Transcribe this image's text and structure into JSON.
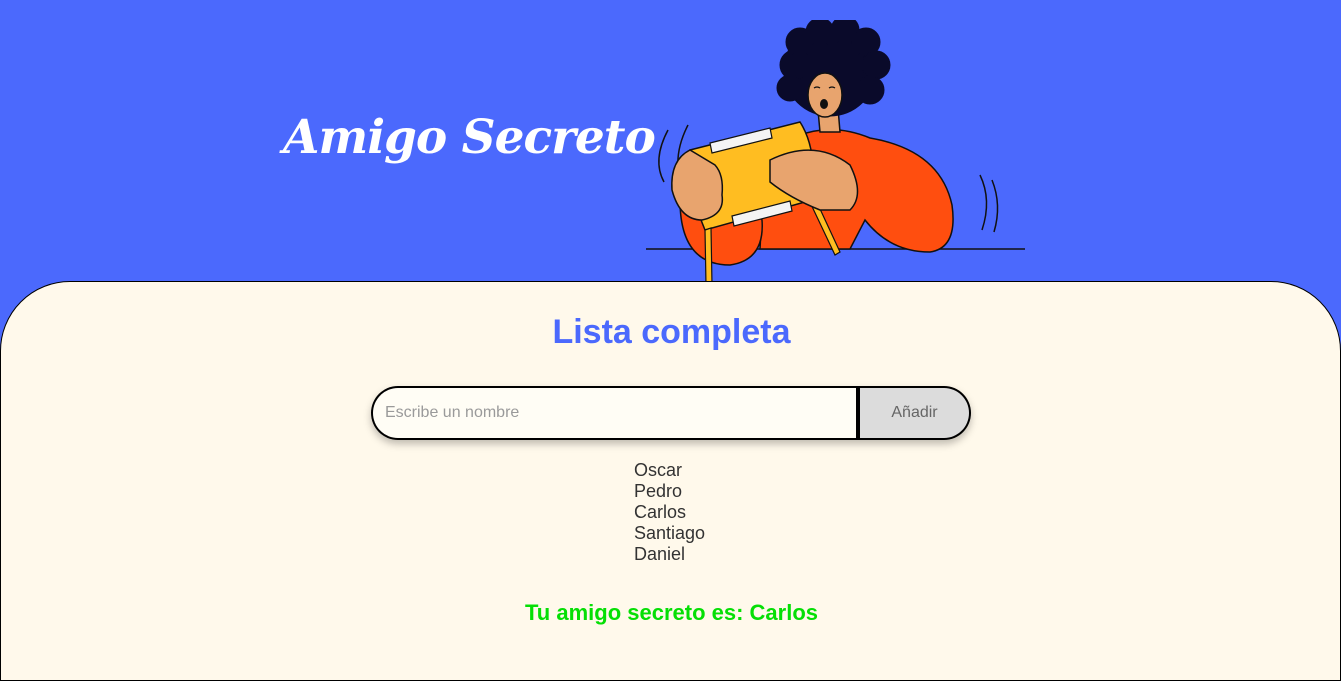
{
  "header": {
    "title": "Amigo Secreto"
  },
  "main": {
    "section_title": "Lista completa",
    "input": {
      "placeholder": "Escribe un nombre",
      "value": ""
    },
    "add_button_label": "Añadir",
    "names": [
      "Oscar",
      "Pedro",
      "Carlos",
      "Santiago",
      "Daniel"
    ],
    "result": "Tu amigo secreto es: Carlos"
  },
  "colors": {
    "primary_blue": "#4B69FD",
    "panel_background": "#FFF9EB",
    "result_green": "#05DF05",
    "button_gray": "#DCDCDC"
  },
  "icons": {
    "illustration": "person-holding-gift-box-illustration"
  }
}
